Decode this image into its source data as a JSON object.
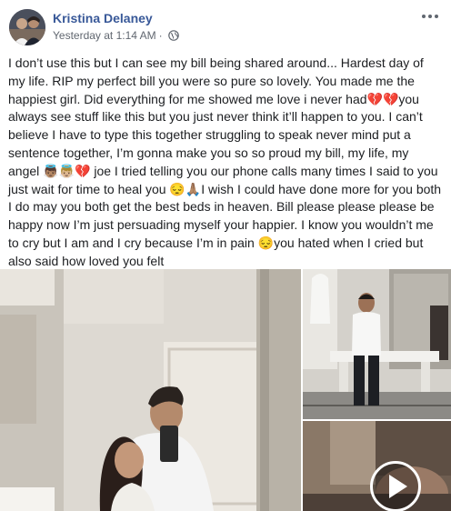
{
  "post": {
    "author": "Kristina Delaney",
    "timestamp": "Yesterday at 1:14 AM",
    "separator": "·",
    "privacy_icon": "globe-icon",
    "more_icon": "more-options-icon",
    "text": "I don’t use this but I can see my bill being shared around... Hardest day of my life. RIP my perfect bill you were so pure so lovely. You made me the happiest girl. Did everything for me showed me love i never had💔💔you always see stuff like this but you just never think it’ll happen to you. I can’t believe I have to type this together struggling to speak never mind put a sentence together, I’m gonna make you so so proud my bill, my life, my angel 👼🏽👼🏼💔 joe I tried telling you our phone calls many times I said to you just wait for time to heal you 😔🙏🏽I wish I could have done more for you both I do may you both get the best beds in heaven. Bill please please please be happy now I’m just persuading myself your happier. I know you wouldn’t me to cry but I am and I cry because I’m in pain 😔you hated when I cried but also said how loved you felt"
  },
  "media": {
    "play_icon": "play-icon"
  },
  "colors": {
    "author": "#385898",
    "meta": "#616770",
    "text": "#1c1e21"
  }
}
